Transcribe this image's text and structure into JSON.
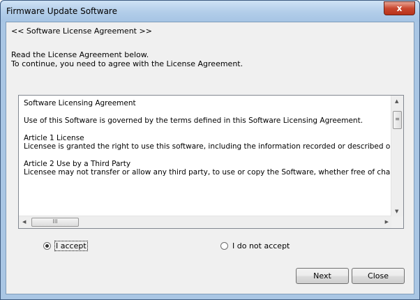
{
  "window": {
    "title": "Firmware Update Software",
    "close_glyph": "x"
  },
  "page": {
    "heading": "<< Software License Agreement >>",
    "intro_line1": "Read the License Agreement below.",
    "intro_line2": "To continue, you need to agree with the License Agreement."
  },
  "license": {
    "title": "Software Licensing Agreement",
    "para1": "Use of this Software is governed by the terms defined in this Software Licensing Agreement.",
    "article1_title": "Article 1 License",
    "article1_text": "Licensee is granted the right to use this software, including the information recorded or described on the",
    "article2_title": "Article 2 Use by a Third Party",
    "article2_text": "Licensee may not transfer or allow any third party, to use or copy the Software, whether free of charge"
  },
  "scrollbars": {
    "up_glyph": "▲",
    "down_glyph": "▼",
    "left_glyph": "◀",
    "right_glyph": "▶",
    "vthumb_grip": "≡",
    "hthumb_grip": "III"
  },
  "options": {
    "accept_label": "I accept",
    "decline_label": "I do not accept",
    "selected": "accept"
  },
  "buttons": {
    "next": "Next",
    "close": "Close"
  },
  "colors": {
    "titlebar": "#b2cde9",
    "client_bg": "#f0f0f0",
    "close_button": "#c9472f"
  }
}
